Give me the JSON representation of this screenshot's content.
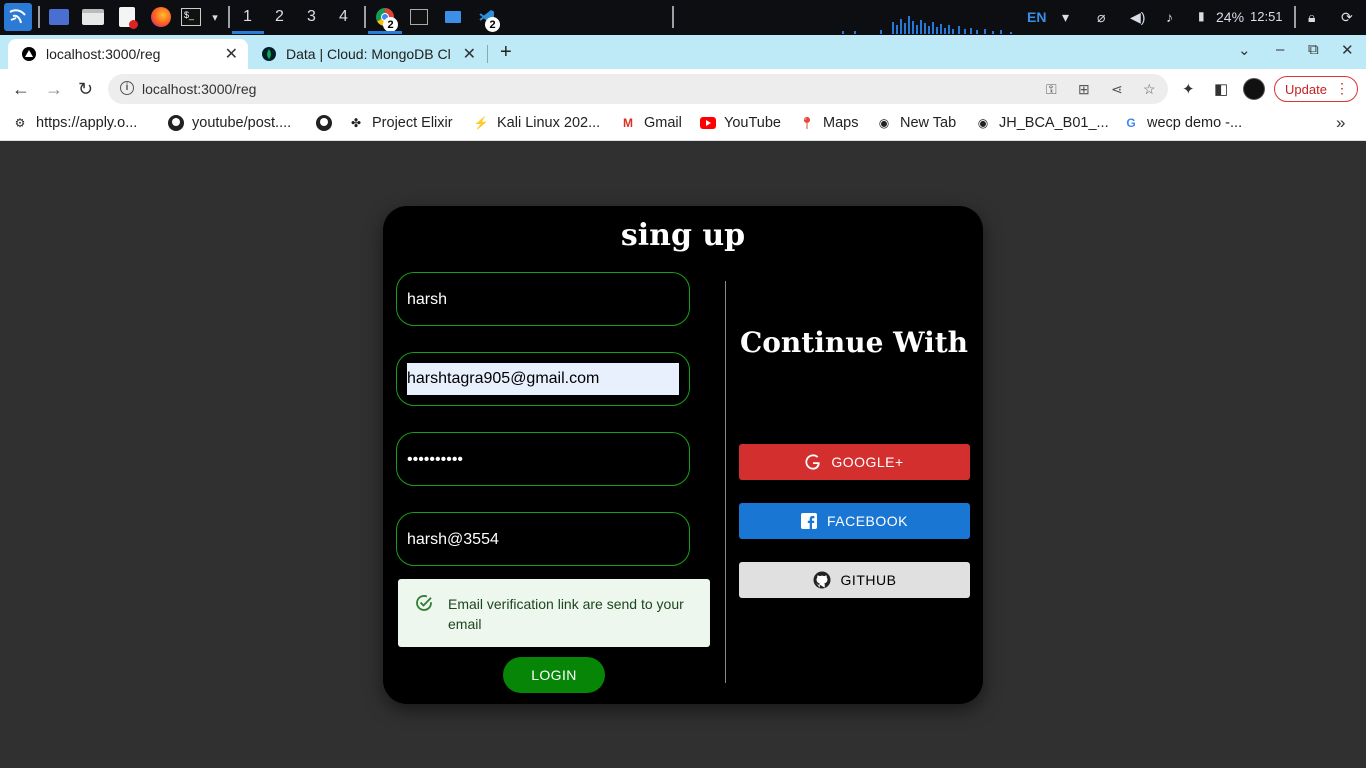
{
  "taskbar": {
    "workspaces": [
      "1",
      "2",
      "3",
      "4"
    ],
    "chrome_badge": "2",
    "vscode_badge": "2",
    "language": "EN",
    "battery": "24%",
    "clock": "12:51"
  },
  "browser": {
    "tabs": [
      {
        "title": "localhost:3000/reg",
        "icon": "triangle-icon",
        "active": true
      },
      {
        "title": "Data | Cloud: MongoDB Cl",
        "icon": "mongodb-leaf-icon",
        "active": false
      }
    ],
    "url": "localhost:3000/reg",
    "update_label": "Update",
    "bookmarks": [
      {
        "label": "https://apply.o...",
        "icon": "gear-icon"
      },
      {
        "label": "youtube/post....",
        "icon": "github-icon"
      },
      {
        "label": "",
        "icon": "github-icon"
      },
      {
        "label": "Project Elixir",
        "icon": "elixir-icon"
      },
      {
        "label": "Kali Linux 202...",
        "icon": "kali-icon"
      },
      {
        "label": "Gmail",
        "icon": "gmail-icon"
      },
      {
        "label": "YouTube",
        "icon": "youtube-icon"
      },
      {
        "label": "Maps",
        "icon": "maps-icon"
      },
      {
        "label": "New Tab",
        "icon": "globe-icon"
      },
      {
        "label": "JH_BCA_B01_...",
        "icon": "globe-icon"
      },
      {
        "label": "wecp demo -...",
        "icon": "google-icon"
      }
    ]
  },
  "page": {
    "title": "sing up",
    "fields": {
      "name": "harsh",
      "email": "harshtagra905@gmail.com",
      "password": "••••••••••",
      "code": "harsh@3554"
    },
    "alert": "Email verification link are send to your email",
    "login_label": "LOGIN",
    "continue_title": "Continue With",
    "social": {
      "google": "GOOGLE+",
      "facebook": "FACEBOOK",
      "github": "GITHUB"
    },
    "colors": {
      "field_border": "#17a017",
      "login_bg": "#078507",
      "google_bg": "#d32f2f",
      "facebook_bg": "#1976d2",
      "github_bg": "#e0e0e0",
      "alert_bg": "#edf7ed"
    }
  }
}
